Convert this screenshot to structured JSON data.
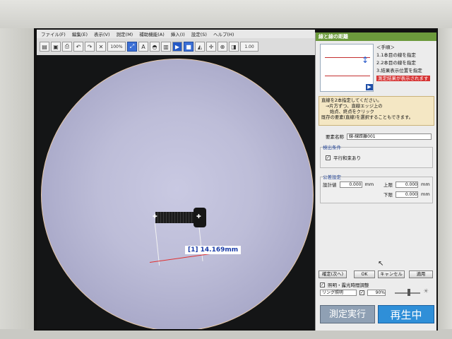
{
  "menu": {
    "file": "ファイル(F)",
    "edit": "編集(E)",
    "view": "表示(V)",
    "measure": "測定(M)",
    "assist": "補助機能(A)",
    "insert": "挿入(I)",
    "settings": "設定(S)",
    "help": "ヘルプ(H)"
  },
  "toolbar": {
    "zoom": "100%",
    "value_box": "1.00"
  },
  "viewport": {
    "measurement": "[1] 14.169mm"
  },
  "panel": {
    "title": "線と線の距離",
    "procedure_title": "＜手順＞",
    "step1": "1.1本目の線を指定",
    "step2": "2.2本目の線を指定",
    "step3": "3.結果表示位置を指定",
    "red_note": "測定結果が表示されます",
    "hint_line1": "直線を2本指定してください。",
    "hint_line2": "→片方ずつ、直線エッジ上の",
    "hint_line3": "始点、終点をクリック",
    "hint_line4": "既存の要素(直線)を選択することもできます。",
    "element_name_label": "要素名称",
    "element_name_value": "線-線距離001",
    "detect_condition": "検出条件",
    "parallel_label": "平行和束あり",
    "tolerance_label": "公差設定",
    "design_value_label": "設計値",
    "design_value": "0.000",
    "upper_label": "上限",
    "upper_value": "0.000",
    "lower_label": "下限",
    "lower_value": "0.000",
    "unit": "mm",
    "confirm_next": "確定(次へ)",
    "ok": "OK",
    "cancel": "キャンセル",
    "apply": "適用",
    "light_adjust": "照明・露光時間調整",
    "ring_light": "リング照明",
    "percent": "90%",
    "measure_run": "測定実行",
    "playing": "再生中"
  },
  "colors": {
    "accent_green": "#6c9a3c",
    "play_blue": "#2f8fd8",
    "run_gray": "#8f9fb0"
  }
}
